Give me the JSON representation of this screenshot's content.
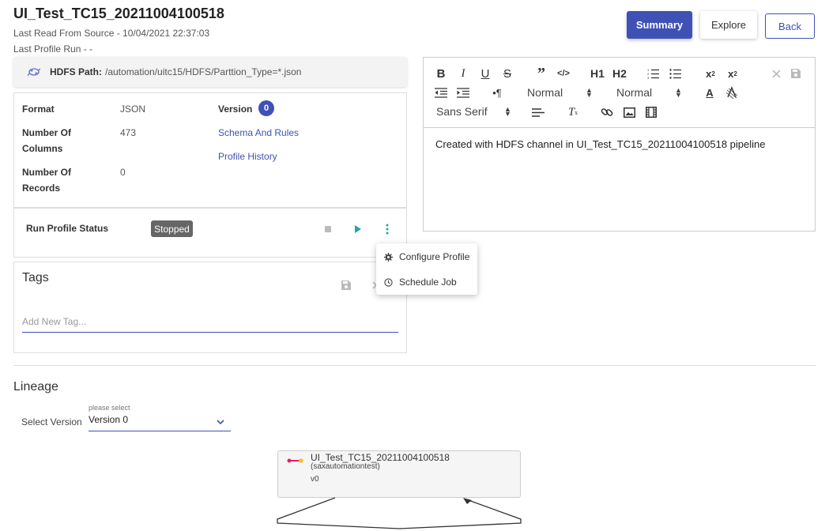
{
  "header": {
    "title": "UI_Test_TC15_20211004100518",
    "last_read": "Last Read From Source - 10/04/2021 22:37:03",
    "last_profile_run": "Last Profile Run - -",
    "summary_label": "Summary",
    "explore_label": "Explore",
    "back_label": "Back"
  },
  "path": {
    "label": "HDFS Path:",
    "value": "/automation/uitc15/HDFS/Parttion_Type=*.json",
    "icon": "hdfs-icon"
  },
  "info": {
    "format_label": "Format",
    "format_value": "JSON",
    "columns_label_1": "Number Of",
    "columns_label_2": "Columns",
    "columns_value": "473",
    "records_label_1": "Number Of",
    "records_label_2": "Records",
    "records_value": "0",
    "version_label": "Version",
    "version_value": "0",
    "schema_link": "Schema And Rules",
    "history_link": "Profile History"
  },
  "status": {
    "label": "Run Profile Status",
    "value": "Stopped",
    "colors": {
      "play": "#26a69a",
      "stop": "#bbbbbb",
      "more": "#26a69a",
      "badge": "#666666"
    }
  },
  "tags": {
    "title": "Tags",
    "placeholder": "Add New Tag..."
  },
  "menu": {
    "items": [
      {
        "label": "Configure Profile",
        "icon": "gear-icon"
      },
      {
        "label": "Schedule Job",
        "icon": "clock-icon"
      }
    ]
  },
  "editor": {
    "toolbar": {
      "h1": "H1",
      "h2": "H2",
      "size": "Normal",
      "header": "Normal",
      "font": "Sans Serif"
    },
    "content": "Created with HDFS channel in UI_Test_TC15_20211004100518 pipeline"
  },
  "lineage": {
    "title": "Lineage",
    "select_label": "Select Version",
    "select_hint": "please select",
    "selected_version": "Version 0",
    "node": {
      "name": "UI_Test_TC15_20211004100518",
      "owner": "(saxautomationtest)",
      "version": "v0"
    }
  },
  "colors": {
    "primary": "#3f51b5",
    "accent": "#26a69a"
  }
}
